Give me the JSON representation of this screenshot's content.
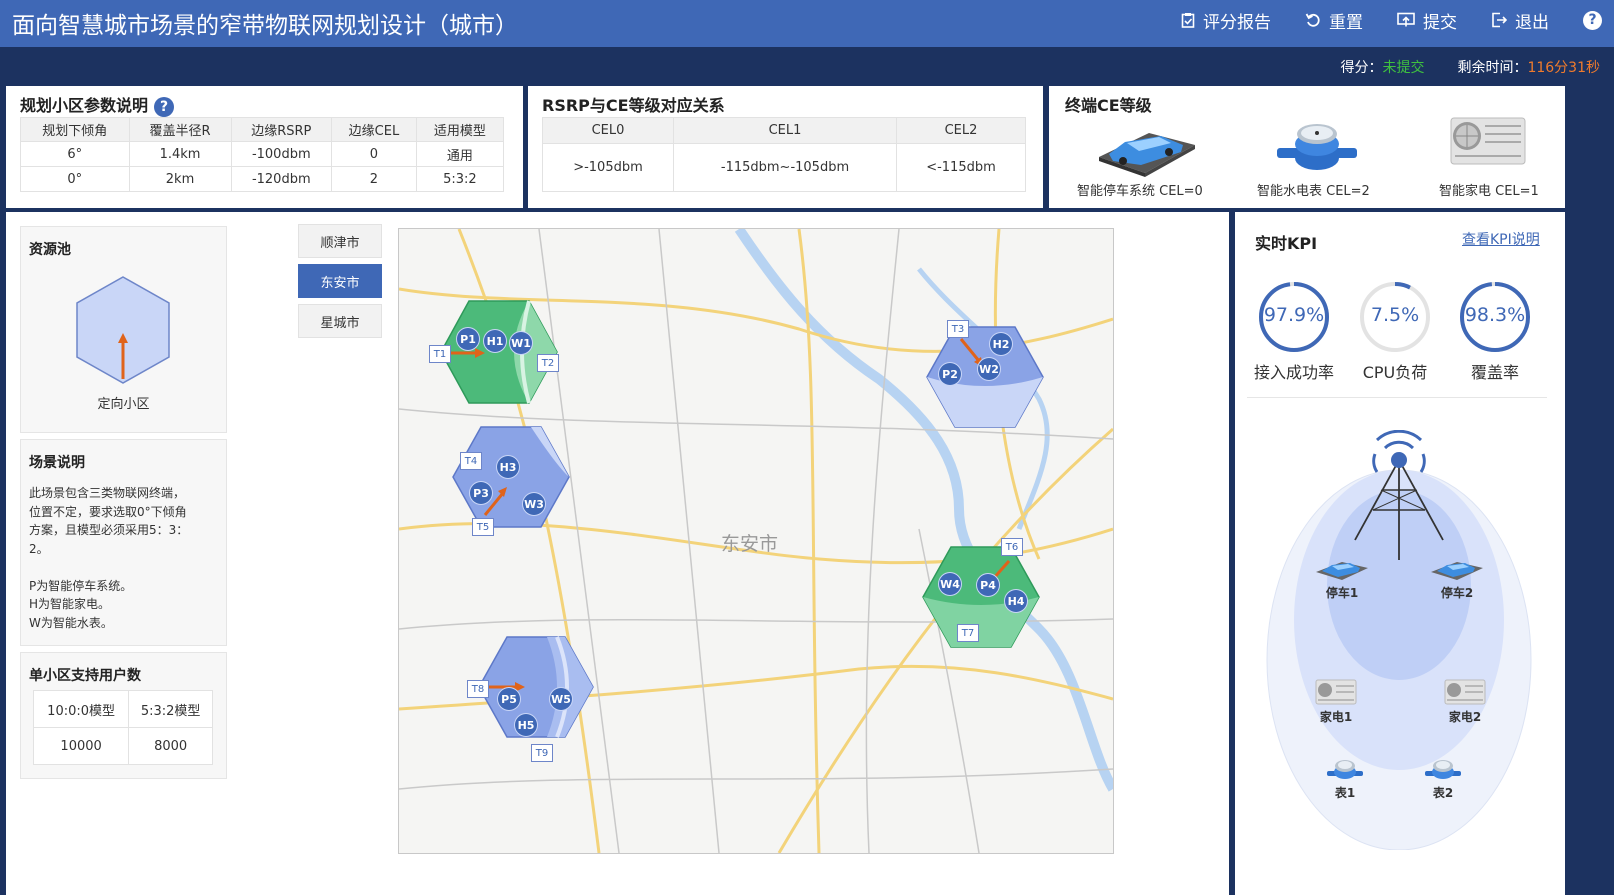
{
  "header": {
    "title": "面向智慧城市场景的窄带物联网规划设计（城市）",
    "actions": [
      {
        "label": "评分报告",
        "icon": "report-icon"
      },
      {
        "label": "重置",
        "icon": "reset-icon"
      },
      {
        "label": "提交",
        "icon": "submit-icon"
      },
      {
        "label": "退出",
        "icon": "exit-icon"
      }
    ],
    "help_label": "?"
  },
  "status": {
    "score_label": "得分：",
    "score_value": "未提交",
    "time_label": "剩余时间：",
    "time_value": "116分31秒"
  },
  "params": {
    "title": "规划小区参数说明",
    "columns": [
      "规划下倾角",
      "覆盖半径R",
      "边缘RSRP",
      "边缘CEL",
      "适用模型"
    ],
    "rows": [
      [
        "6°",
        "1.4km",
        "-100dbm",
        "0",
        "通用"
      ],
      [
        "0°",
        "2km",
        "-120dbm",
        "2",
        "5:3:2"
      ]
    ]
  },
  "rsrp": {
    "title": "RSRP与CE等级对应关系",
    "columns": [
      "CEL0",
      "CEL1",
      "CEL2"
    ],
    "row": [
      ">-105dbm",
      "-115dbm~-105dbm",
      "<-115dbm"
    ]
  },
  "terminal": {
    "title": "终端CE等级",
    "items": [
      {
        "label": "智能停车系统 CEL=0",
        "icon": "parking-car-icon"
      },
      {
        "label": "智能水电表 CEL=2",
        "icon": "water-meter-icon"
      },
      {
        "label": "智能家电 CEL=1",
        "icon": "appliance-icon"
      }
    ]
  },
  "resource": {
    "title": "资源池",
    "cell_label": "定向小区"
  },
  "scene": {
    "title": "场景说明",
    "lines": [
      "此场景包含三类物联网终端，",
      "位置不定，要求选取0°下倾角",
      "方案，且模型必须采用5：3：",
      "2。",
      "",
      "P为智能停车系统。",
      "H为智能家电。",
      "W为智能水表。"
    ]
  },
  "users": {
    "title": "单小区支持用户数",
    "columns": [
      "10:0:0模型",
      "5:3:2模型"
    ],
    "row": [
      "10000",
      "8000"
    ]
  },
  "cities": [
    {
      "label": "顺津市",
      "active": false
    },
    {
      "label": "东安市",
      "active": true
    },
    {
      "label": "星城市",
      "active": false
    }
  ],
  "map": {
    "city_label": "东安市",
    "cells": [
      {
        "id": "cell-1",
        "color": "green",
        "terminals": [
          "P1",
          "H1",
          "W1"
        ],
        "tags": [
          "T1",
          "T2"
        ]
      },
      {
        "id": "cell-2",
        "color": "blue",
        "terminals": [
          "H3",
          "P3",
          "W3"
        ],
        "tags": [
          "T4",
          "T5"
        ]
      },
      {
        "id": "cell-3",
        "color": "blue",
        "terminals": [
          "P5",
          "W5",
          "H5"
        ],
        "tags": [
          "T8",
          "T9"
        ]
      },
      {
        "id": "cell-4",
        "color": "blue",
        "terminals": [
          "H2",
          "P2",
          "W2"
        ],
        "tags": [
          "T3"
        ]
      },
      {
        "id": "cell-5",
        "color": "green",
        "terminals": [
          "W4",
          "P4",
          "H4"
        ],
        "tags": [
          "T6",
          "T7"
        ]
      }
    ]
  },
  "kpi": {
    "title": "实时KPI",
    "link": "查看KPI说明",
    "gauges": [
      {
        "label": "接入成功率",
        "value": "97.9%",
        "fraction": 0.979
      },
      {
        "label": "CPU负荷",
        "value": "7.5%",
        "fraction": 0.075
      },
      {
        "label": "覆盖率",
        "value": "98.3%",
        "fraction": 0.983
      }
    ],
    "devices": [
      "停车1",
      "停车2",
      "家电1",
      "家电2",
      "表1",
      "表2"
    ]
  },
  "colors": {
    "header": "#3f68b6",
    "background": "#1c3260",
    "accent": "#3f68b6",
    "green_cell": "#4cba7a",
    "blue_cell": "#8aa3e6",
    "score": "#3fc13f",
    "time": "#f07b2c"
  }
}
